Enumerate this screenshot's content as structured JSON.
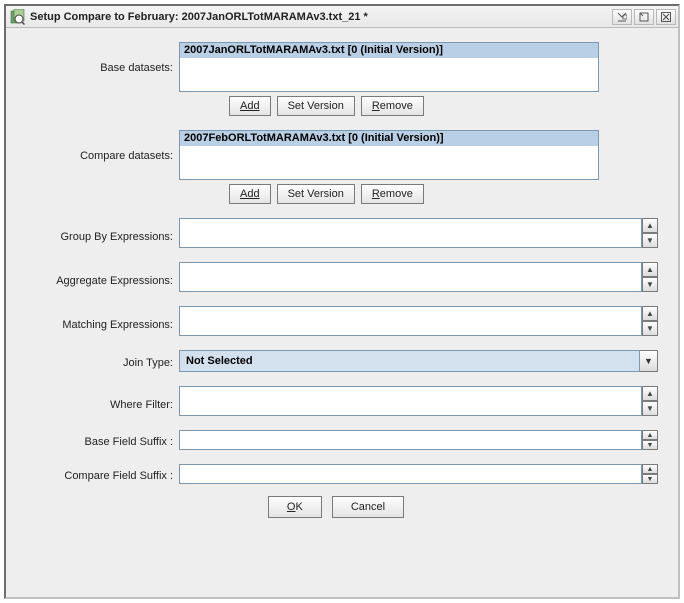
{
  "title": "Setup Compare to February: 2007JanORLTotMARAMAv3.txt_21 *",
  "labels": {
    "base_datasets": "Base datasets:",
    "compare_datasets": "Compare datasets:",
    "group_by": "Group By Expressions:",
    "aggregate": "Aggregate Expressions:",
    "matching": "Matching Expressions:",
    "join_type": "Join Type:",
    "where_filter": "Where Filter:",
    "base_suffix": "Base Field Suffix :",
    "compare_suffix": "Compare Field Suffix :"
  },
  "base_datasets": {
    "items": [
      "2007JanORLTotMARAMAv3.txt [0 (Initial Version)]"
    ]
  },
  "compare_datasets": {
    "items": [
      "2007FebORLTotMARAMAv3.txt [0 (Initial Version)]"
    ]
  },
  "buttons": {
    "add": "Add",
    "set_version": "Set Version",
    "remove": "Remove",
    "ok": "OK",
    "cancel": "Cancel"
  },
  "fields": {
    "group_by": "",
    "aggregate": "",
    "matching": "",
    "join_type": "Not Selected",
    "where_filter": "",
    "base_suffix": "",
    "compare_suffix": ""
  }
}
